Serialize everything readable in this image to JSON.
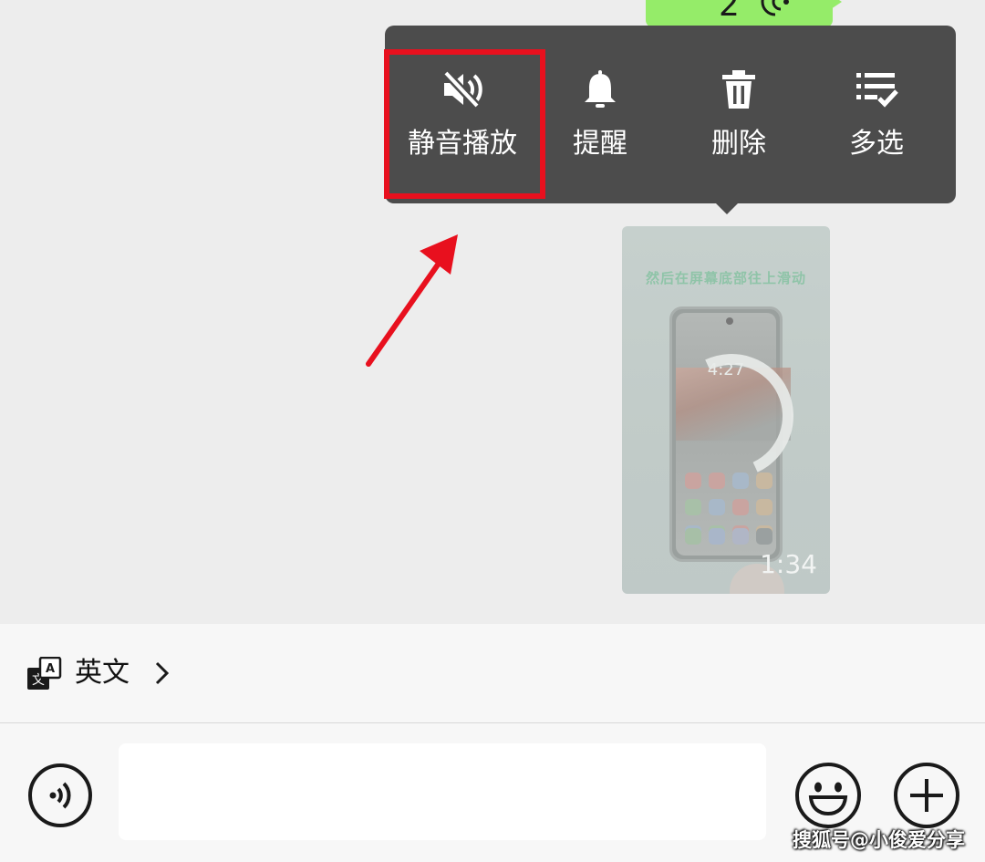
{
  "chat": {
    "voice_message": {
      "duration": "2",
      "icon": "voice-waves-icon",
      "bubble_color": "#95ec69"
    },
    "video_message": {
      "caption": "然后在屏幕底部往上滑动",
      "phone_clock": "4:27",
      "duration": "1:34"
    }
  },
  "context_menu": {
    "background": "#4c4c4c",
    "items": [
      {
        "label": "静音播放",
        "icon": "speaker-muted-icon",
        "highlighted": true
      },
      {
        "label": "提醒",
        "icon": "bell-icon"
      },
      {
        "label": "删除",
        "icon": "trash-icon"
      },
      {
        "label": "多选",
        "icon": "multi-select-icon"
      }
    ],
    "highlight_color": "#e8101e"
  },
  "translate_bar": {
    "icon": "translate-icon",
    "label": "英文",
    "chevron": "chevron-right-icon"
  },
  "input_bar": {
    "voice_toggle_icon": "voice-input-icon",
    "text_value": "",
    "emoji_icon": "emoji-icon",
    "plus_icon": "plus-icon"
  },
  "watermark": "搜狐号@小俊爱分享"
}
